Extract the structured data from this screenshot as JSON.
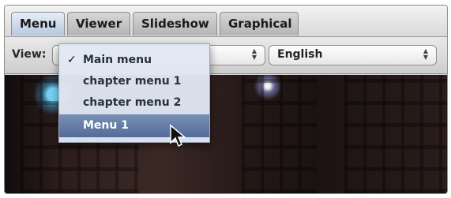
{
  "tabs": [
    {
      "label": "Menu",
      "active": true
    },
    {
      "label": "Viewer",
      "active": false
    },
    {
      "label": "Slideshow",
      "active": false
    },
    {
      "label": "Graphical",
      "active": false
    }
  ],
  "toolbar": {
    "view_label": "View:",
    "view_popup_value": "",
    "language_popup_value": "English"
  },
  "menu": {
    "items": [
      {
        "label": "Main menu",
        "checked": true,
        "selected": false
      },
      {
        "label": "chapter menu 1",
        "checked": false,
        "selected": false
      },
      {
        "label": "chapter menu 2",
        "checked": false,
        "selected": false
      },
      {
        "label": "Menu 1",
        "checked": false,
        "selected": true
      }
    ],
    "checkmark": "✓"
  },
  "icons": {
    "stepper": "up-down-arrows-icon",
    "cursor": "arrow-cursor-icon"
  },
  "colors": {
    "selected_menu_bg": "#5f789f",
    "menu_text": "#27313f",
    "selected_text": "#ffffff"
  }
}
